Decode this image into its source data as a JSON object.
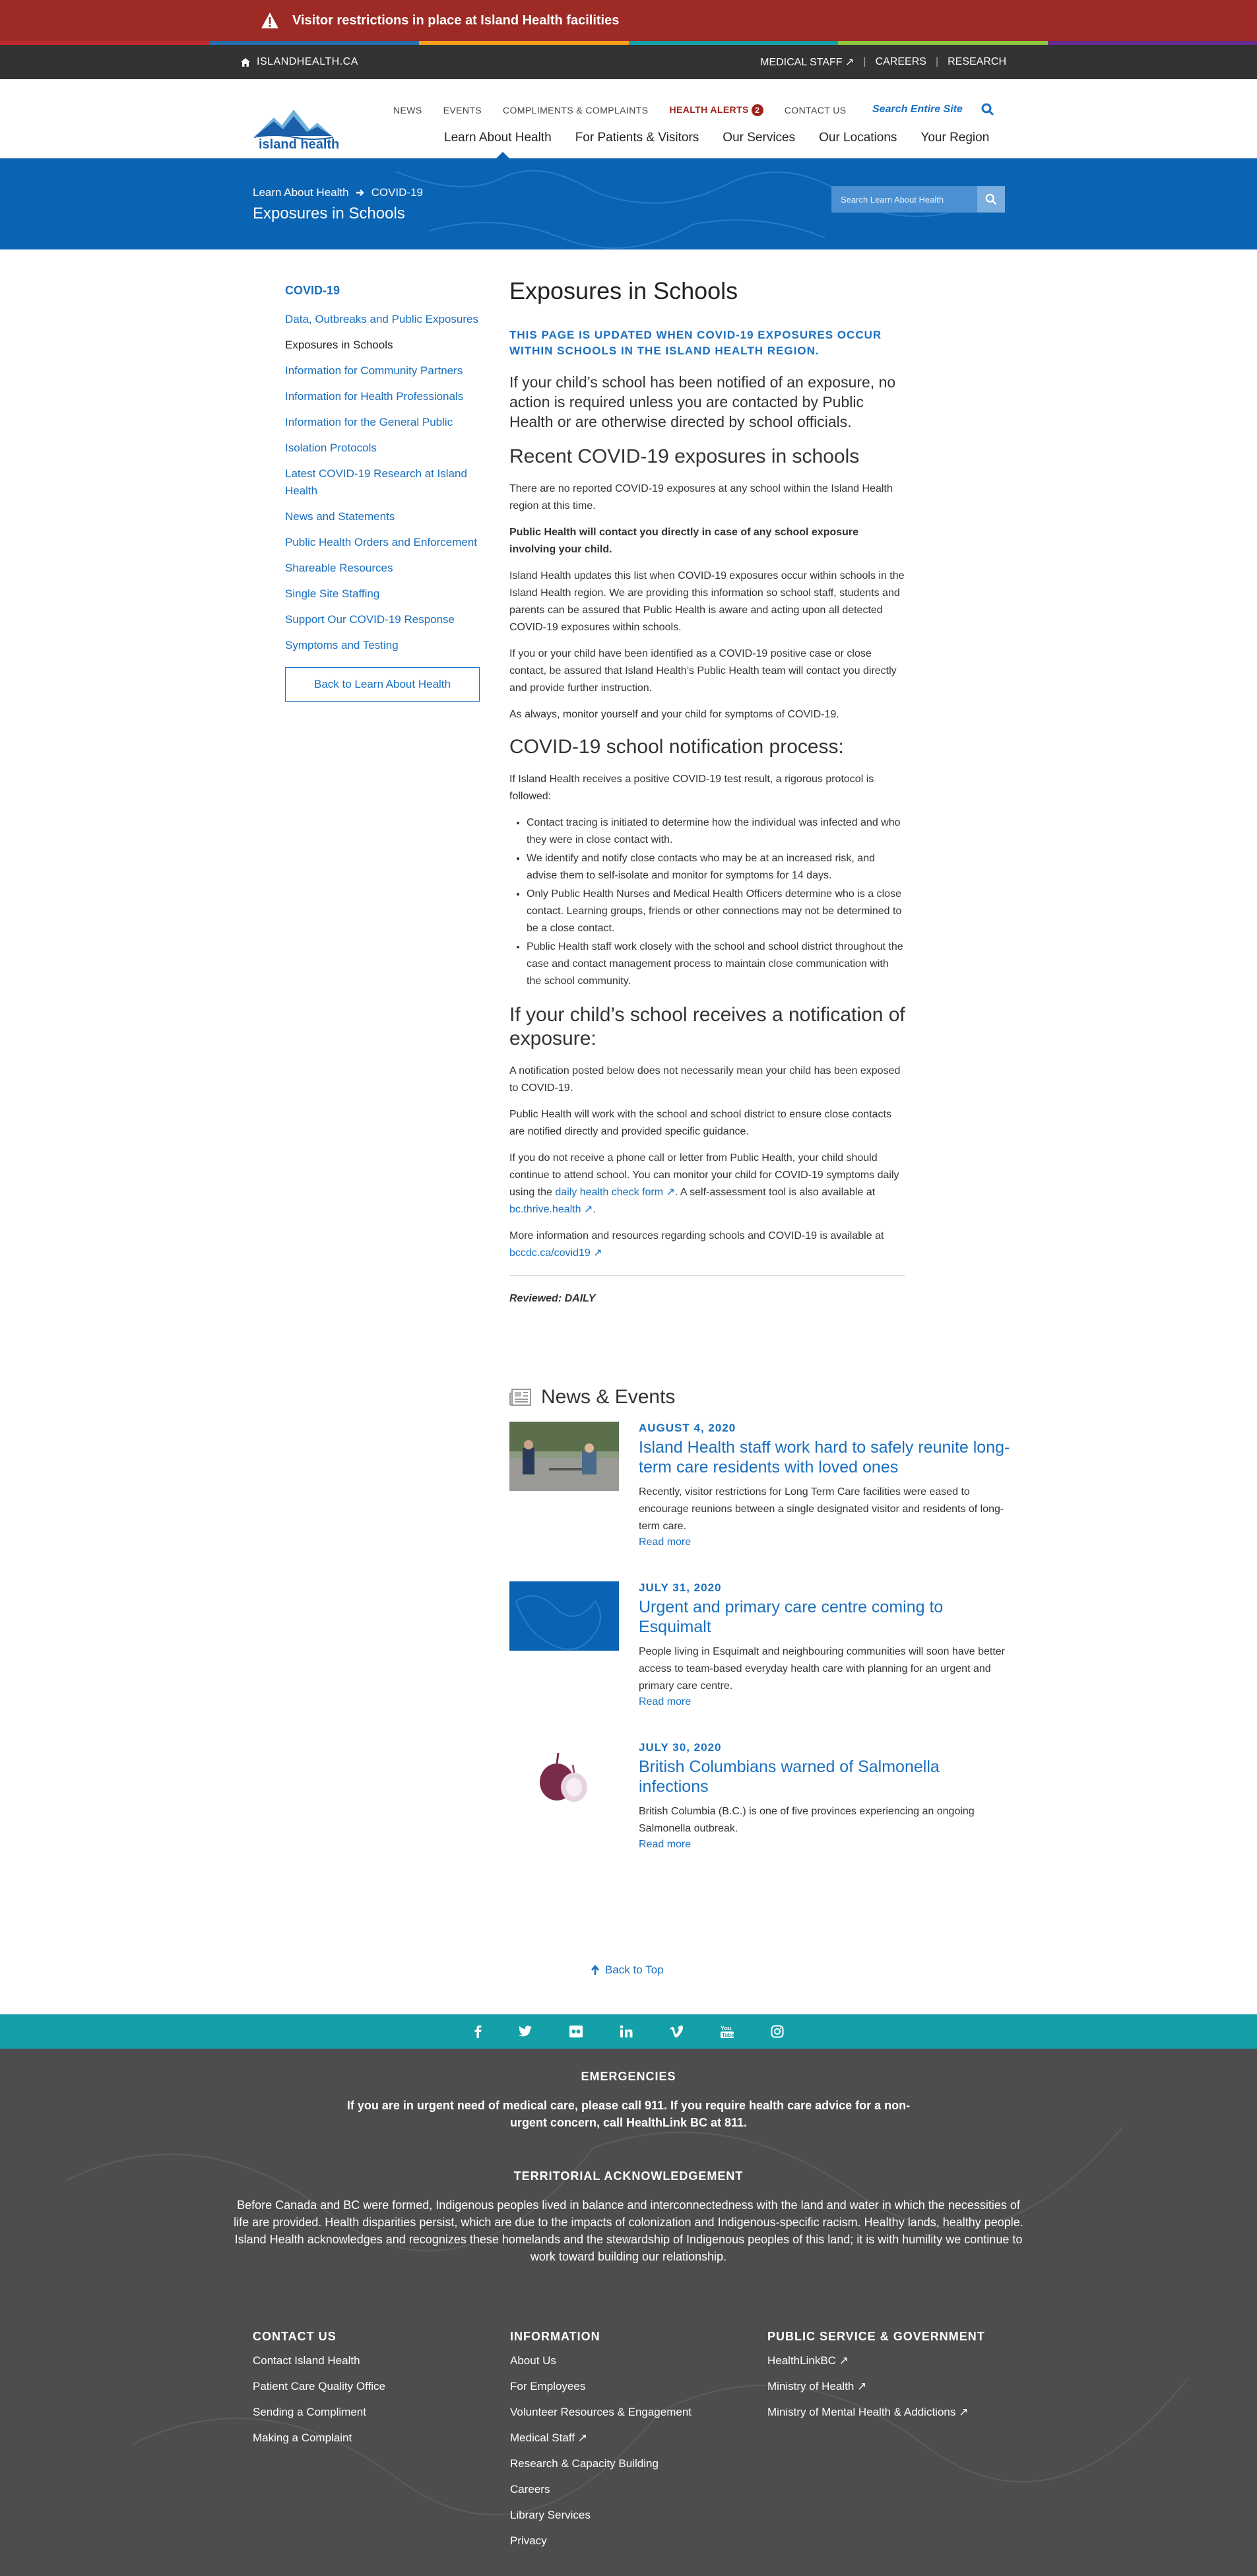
{
  "alert": {
    "text": "Visitor restrictions in place at Island Health facilities"
  },
  "colors": {
    "alert": "#9e2a25",
    "topbar": "#333333",
    "brand_blue": "#0a64b4",
    "link": "#1a6fbf",
    "teal": "#14a0a8",
    "footer": "#4d4d4f",
    "stripes": [
      "#c1272d",
      "#2a6cb0",
      "#f6a01a",
      "#14a0a8",
      "#8dc63f",
      "#662d91"
    ]
  },
  "topbar": {
    "home": "ISLANDHEALTH.CA",
    "links": [
      "MEDICAL STAFF",
      "CAREERS",
      "RESEARCH"
    ]
  },
  "header": {
    "logo_text": "island health",
    "utility": [
      "NEWS",
      "EVENTS",
      "COMPLIMENTS & COMPLAINTS",
      "HEALTH ALERTS",
      "CONTACT US"
    ],
    "alerts_count": "2",
    "search_label": "Search Entire Site",
    "main": [
      "Learn About Health",
      "For Patients & Visitors",
      "Our Services",
      "Our Locations",
      "Your Region"
    ]
  },
  "banner": {
    "crumb1": "Learn About Health",
    "crumb2": "COVID-19",
    "title": "Exposures in Schools",
    "search_placeholder": "Search Learn About Health"
  },
  "sidebar": {
    "title": "COVID-19",
    "items": [
      "Data, Outbreaks and Public Exposures",
      "Exposures in Schools",
      "Information for Community Partners",
      "Information for Health Professionals",
      "Information for the General Public",
      "Isolation Protocols",
      "Latest COVID-19 Research at Island Health",
      "News and Statements",
      "Public Health Orders and Enforcement",
      "Shareable Resources",
      "Single Site Staffing",
      "Support Our COVID-19 Response",
      "Symptoms and Testing"
    ],
    "back": "Back to Learn About Health"
  },
  "main": {
    "title": "Exposures in Schools",
    "update": "THIS PAGE IS UPDATED WHEN COVID-19 EXPOSURES OCCUR WITHIN SCHOOLS IN THE ISLAND HEALTH REGION.",
    "lead": "If your child’s school has been notified of an exposure, no action is required unless you are contacted by Public Health or are otherwise directed by school officials.",
    "h_recent": "Recent COVID-19 exposures in schools",
    "p1": "There are no reported COVID-19 exposures at any school within the Island Health region at this time.",
    "p2": "Public Health will contact you directly in case of any school exposure involving your child.",
    "p3": "Island Health updates this list when COVID-19 exposures occur within schools in the Island Health region. We are providing this information so school staff, students and parents can be assured that Public Health is aware and acting upon all detected COVID-19 exposures within schools.",
    "p4": "If you or your child have been identified as a COVID-19 positive case or close contact, be assured that Island Health’s Public Health team will contact you directly and provide further instruction.",
    "p5": "As always, monitor yourself and your child for symptoms of COVID-19.",
    "h_process": "COVID-19 school notification process:",
    "p6": "If Island Health receives a positive COVID-19 test result, a rigorous protocol is followed:",
    "bullets": [
      "Contact tracing is initiated to determine how the individual was infected and who they were in close contact with.",
      "We identify and notify close contacts who may be at an increased risk, and advise them to self-isolate and monitor for symptoms for 14 days.",
      "Only Public Health Nurses and Medical Health Officers determine who is a close contact. Learning groups, friends or other connections may not be determined to be a close contact.",
      "Public Health staff work closely with the school and school district throughout the case and contact management process to maintain close communication with the school community."
    ],
    "h_notify": "If your child’s school receives a notification of exposure:",
    "p7": "A notification posted below does not necessarily mean your child has been exposed to COVID-19.",
    "p8": "Public Health will work with the school and school district to ensure close contacts are notified directly and provided specific guidance.",
    "p9a": "If you do not receive a phone call or letter from Public Health, your child should continue to attend school. You can monitor your child for COVID-19 symptoms daily using the ",
    "p9link1": "daily health check form",
    "p9b": ". A self-assessment tool is also available at ",
    "p9link2": "bc.thrive.health",
    "p9c": ".",
    "p10a": "More information and resources regarding schools and COVID-19 is available at ",
    "p10link": "bccdc.ca/covid19",
    "reviewed": "Reviewed: DAILY"
  },
  "news": {
    "heading": "News & Events",
    "items": [
      {
        "date": "AUGUST 4, 2020",
        "title": "Island Health staff work hard to safely reunite long-term care residents with loved ones",
        "desc": "Recently, visitor restrictions for Long Term Care facilities were eased to encourage reunions between a single designated visitor and residents of long-term care.",
        "more": "Read more"
      },
      {
        "date": "JULY 31, 2020",
        "title": "Urgent and primary care centre coming to Esquimalt",
        "desc": "People living in Esquimalt and neighbouring communities will soon have better access to team-based everyday health care with planning for an urgent and primary care centre.",
        "more": "Read more"
      },
      {
        "date": "JULY 30, 2020",
        "title": "British Columbians warned of Salmonella infections",
        "desc": "British Columbia (B.C.) is one of five provinces experiencing an ongoing Salmonella outbreak.",
        "more": "Read more"
      }
    ]
  },
  "backtop": "Back to Top",
  "footer": {
    "emerg_h": "EMERGENCIES",
    "emerg_t": "If you are in urgent need of medical care, please call 911. If you require health care advice for a non-urgent concern, call HealthLink BC at 811.",
    "terr_h": "TERRITORIAL ACKNOWLEDGEMENT",
    "terr_t": "Before Canada and BC were formed, Indigenous peoples lived in balance and interconnectedness with the land and water in which the necessities of life are provided. Health disparities persist, which are due to the impacts of colonization and Indigenous-specific racism. Healthy lands, healthy people. Island Health acknowledges and recognizes these homelands and the stewardship of Indigenous peoples of this land; it is with humility we continue to work toward building our relationship.",
    "c1_h": "CONTACT US",
    "c1": [
      "Contact Island Health",
      "Patient Care Quality Office",
      "Sending a Compliment",
      "Making a Complaint"
    ],
    "c2_h": "INFORMATION",
    "c2": [
      "About Us",
      "For Employees",
      "Volunteer Resources & Engagement",
      "Medical Staff",
      "Research & Capacity Building",
      "Careers",
      "Library Services",
      "Privacy"
    ],
    "c3_h": "PUBLIC SERVICE & GOVERNMENT",
    "c3": [
      "HealthLinkBC",
      "Ministry of Health",
      "Ministry of Mental Health & Addictions"
    ]
  }
}
